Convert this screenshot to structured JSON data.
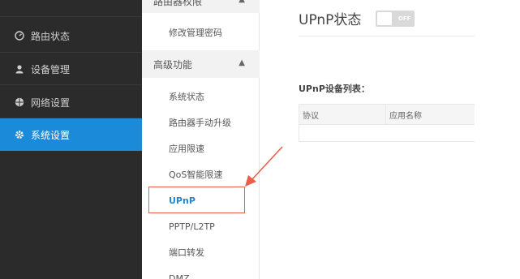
{
  "nav": {
    "items": [
      {
        "label": "路由状态",
        "icon": "dashboard-icon"
      },
      {
        "label": "设备管理",
        "icon": "user-icon"
      },
      {
        "label": "网络设置",
        "icon": "globe-icon"
      },
      {
        "label": "系统设置",
        "icon": "gear-icon",
        "active": true
      }
    ]
  },
  "submenu": {
    "group_top_label": "路由器权限",
    "group_top_items": [
      "修改管理密码"
    ],
    "group_advanced_label": "高级功能",
    "advanced_items": [
      "系统状态",
      "路由器手动升级",
      "应用限速",
      "QoS智能限速",
      "UPnP",
      "PPTP/L2TP",
      "端口转发",
      "DMZ"
    ],
    "selected": "UPnP"
  },
  "main": {
    "title": "UPnP状态",
    "toggle_state": "OFF",
    "list_title": "UPnP设备列表：",
    "table_headers": [
      "协议",
      "应用名称"
    ]
  },
  "colors": {
    "accent": "#1a8ad9",
    "sidebar_bg": "#2b2b2b",
    "annotation": "#e8604a"
  }
}
